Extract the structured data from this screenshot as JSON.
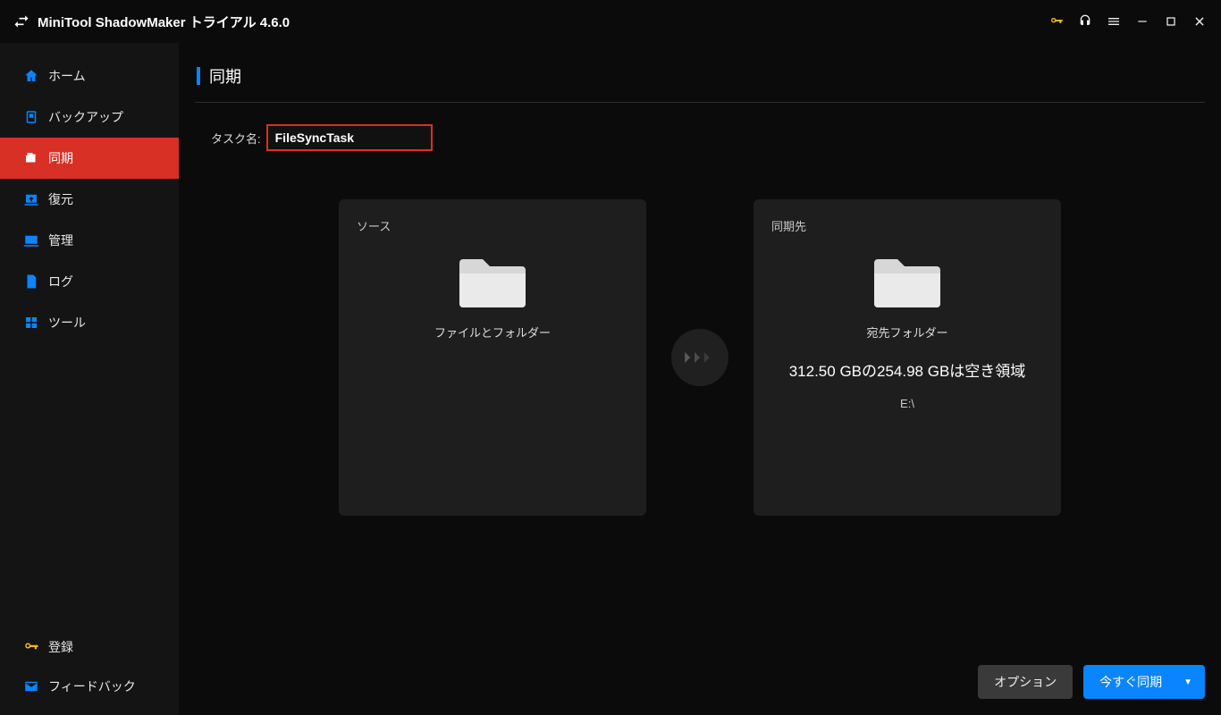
{
  "app": {
    "title": "MiniTool ShadowMaker トライアル 4.6.0"
  },
  "sidebar": {
    "items": [
      {
        "label": "ホーム"
      },
      {
        "label": "バックアップ"
      },
      {
        "label": "同期"
      },
      {
        "label": "復元"
      },
      {
        "label": "管理"
      },
      {
        "label": "ログ"
      },
      {
        "label": "ツール"
      }
    ],
    "register": "登録",
    "feedback": "フィードバック"
  },
  "page": {
    "title": "同期",
    "task_label": "タスク名:",
    "task_value": "FileSyncTask"
  },
  "source_panel": {
    "title": "ソース",
    "line1": "ファイルとフォルダー"
  },
  "dest_panel": {
    "title": "同期先",
    "line1": "宛先フォルダー",
    "line2": "312.50 GBの254.98 GBは空き領域",
    "line3": "E:\\"
  },
  "buttons": {
    "options": "オプション",
    "sync_now": "今すぐ同期"
  }
}
